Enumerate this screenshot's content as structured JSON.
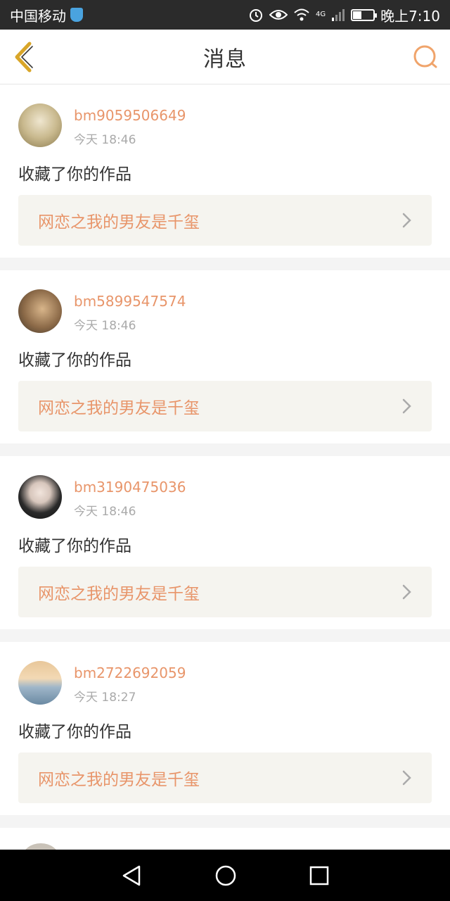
{
  "status_bar": {
    "carrier": "中国移动",
    "network": "4G",
    "time": "晚上7:10"
  },
  "header": {
    "title": "消息",
    "back_icon": "chevron-left-icon",
    "search_icon": "search-icon"
  },
  "colors": {
    "accent": "#e8956a",
    "back_icon": "#d9a629",
    "card_link_bg": "#f5f4ef"
  },
  "messages": [
    {
      "username": "bm9059506649",
      "time": "今天 18:46",
      "action": "收藏了你的作品",
      "work_title": "网恋之我的男友是千玺"
    },
    {
      "username": "bm5899547574",
      "time": "今天 18:46",
      "action": "收藏了你的作品",
      "work_title": "网恋之我的男友是千玺"
    },
    {
      "username": "bm3190475036",
      "time": "今天 18:46",
      "action": "收藏了你的作品",
      "work_title": "网恋之我的男友是千玺"
    },
    {
      "username": "bm2722692059",
      "time": "今天 18:27",
      "action": "收藏了你的作品",
      "work_title": "网恋之我的男友是千玺"
    }
  ],
  "nav": {
    "back": "triangle-back-icon",
    "home": "circle-home-icon",
    "recents": "square-recents-icon"
  }
}
